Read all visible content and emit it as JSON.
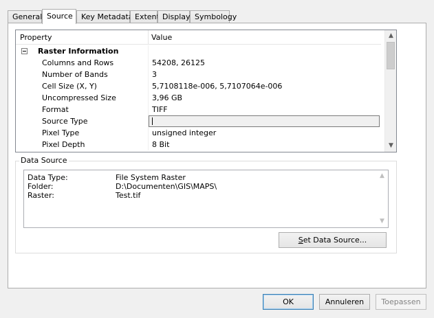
{
  "tabs": [
    {
      "label": "General",
      "active": false
    },
    {
      "label": "Source",
      "active": true
    },
    {
      "label": "Key Metadata",
      "active": false
    },
    {
      "label": "Extent",
      "active": false
    },
    {
      "label": "Display",
      "active": false
    },
    {
      "label": "Symbology",
      "active": false
    }
  ],
  "grid": {
    "header_property": "Property",
    "header_value": "Value",
    "group_label": "Raster Information",
    "rows": [
      {
        "property": "Columns and Rows",
        "value": "54208, 26125"
      },
      {
        "property": "Number of Bands",
        "value": "3"
      },
      {
        "property": "Cell Size (X, Y)",
        "value": "5,7108118e-006, 5,7107064e-006"
      },
      {
        "property": "Uncompressed Size",
        "value": "3,96 GB"
      },
      {
        "property": "Format",
        "value": "TIFF"
      },
      {
        "property": "Source Type",
        "value": ""
      },
      {
        "property": "Pixel Type",
        "value": "unsigned integer"
      },
      {
        "property": "Pixel Depth",
        "value": "8 Bit"
      }
    ]
  },
  "data_source": {
    "label": "Data Source",
    "rows": [
      {
        "key": "Data Type:",
        "value": "File System Raster"
      },
      {
        "key": "Folder:",
        "value": "D:\\Documenten\\GIS\\MAPS\\"
      },
      {
        "key": "Raster:",
        "value": "Test.tif"
      }
    ],
    "set_button_first": "S",
    "set_button_rest": "et Data Source..."
  },
  "buttons": {
    "ok": "OK",
    "cancel": "Annuleren",
    "apply": "Toepassen"
  },
  "icons": {
    "expander": "collapse-minus-icon",
    "scroll_up": "scroll-up-arrow-icon",
    "scroll_down": "scroll-down-arrow-icon"
  }
}
